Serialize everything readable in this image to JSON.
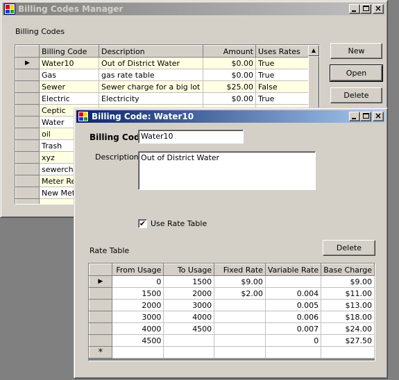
{
  "main_window": {
    "title": "Billing Codes Manager",
    "group_label": "Billing Codes",
    "columns": [
      "Billing Code",
      "Description",
      "Amount",
      "Uses Rates"
    ],
    "rows": [
      {
        "code": "Water10",
        "description": "Out of District Water",
        "amount": "$0.00",
        "uses_rates": "True",
        "current": true
      },
      {
        "code": "Gas",
        "description": "gas rate table",
        "amount": "$0.00",
        "uses_rates": "True"
      },
      {
        "code": "Sewer",
        "description": "Sewer charge for a big lot",
        "amount": "$25.00",
        "uses_rates": "False"
      },
      {
        "code": "Electric",
        "description": "Electricity",
        "amount": "$0.00",
        "uses_rates": "True"
      },
      {
        "code": "Ceptic",
        "description": "",
        "amount": "",
        "uses_rates": ""
      },
      {
        "code": "Water",
        "description": "",
        "amount": "",
        "uses_rates": ""
      },
      {
        "code": "oil",
        "description": "",
        "amount": "",
        "uses_rates": ""
      },
      {
        "code": "Trash",
        "description": "",
        "amount": "",
        "uses_rates": ""
      },
      {
        "code": "xyz",
        "description": "",
        "amount": "",
        "uses_rates": ""
      },
      {
        "code": "sewerchec",
        "description": "",
        "amount": "",
        "uses_rates": ""
      },
      {
        "code": "Meter Rep",
        "description": "",
        "amount": "",
        "uses_rates": ""
      },
      {
        "code": "New Mete",
        "description": "",
        "amount": "",
        "uses_rates": ""
      },
      {
        "code": "",
        "description": "",
        "amount": "",
        "uses_rates": ""
      }
    ],
    "buttons": {
      "new": "New",
      "open": "Open",
      "delete": "Delete"
    }
  },
  "dialog": {
    "title": "Billing Code: Water10",
    "billing_code_label": "Billing Code",
    "billing_code_value": "Water10",
    "description_label": "Description",
    "description_value": "Out of District Water",
    "use_rate_table_label": "Use Rate Table",
    "use_rate_table_checked": "✔",
    "rate_table_label": "Rate Table",
    "delete_button": "Delete",
    "rate_columns": [
      "From Usage",
      "To Usage",
      "Fixed Rate",
      "Variable Rate",
      "Base Charge"
    ],
    "rate_rows": [
      {
        "from": "0",
        "to": "1500",
        "fixed": "$9.00",
        "variable": "",
        "base": "$9.00",
        "current": true
      },
      {
        "from": "1500",
        "to": "2000",
        "fixed": "$2.00",
        "variable": "0.004",
        "base": "$11.00"
      },
      {
        "from": "2000",
        "to": "3000",
        "fixed": "",
        "variable": "0.005",
        "base": "$13.00"
      },
      {
        "from": "3000",
        "to": "4000",
        "fixed": "",
        "variable": "0.006",
        "base": "$18.00"
      },
      {
        "from": "4000",
        "to": "4500",
        "fixed": "",
        "variable": "0.007",
        "base": "$24.00"
      },
      {
        "from": "4500",
        "to": "",
        "fixed": "",
        "variable": "0",
        "base": "$27.50"
      },
      {
        "from": "",
        "to": "",
        "fixed": "",
        "variable": "",
        "base": "",
        "new_row": true
      }
    ],
    "current_row_glyph": "▶",
    "new_row_glyph": "*"
  },
  "icons": {
    "app": "app-icon",
    "minimize": "minimize-icon",
    "maximize": "maximize-icon",
    "close": "close-icon"
  },
  "colors": {
    "active_title_start": "#0a246a",
    "active_title_end": "#a6caf0",
    "inactive_title": "#808080",
    "alt_row": "#ffffe1",
    "face": "#d4d0c8"
  }
}
